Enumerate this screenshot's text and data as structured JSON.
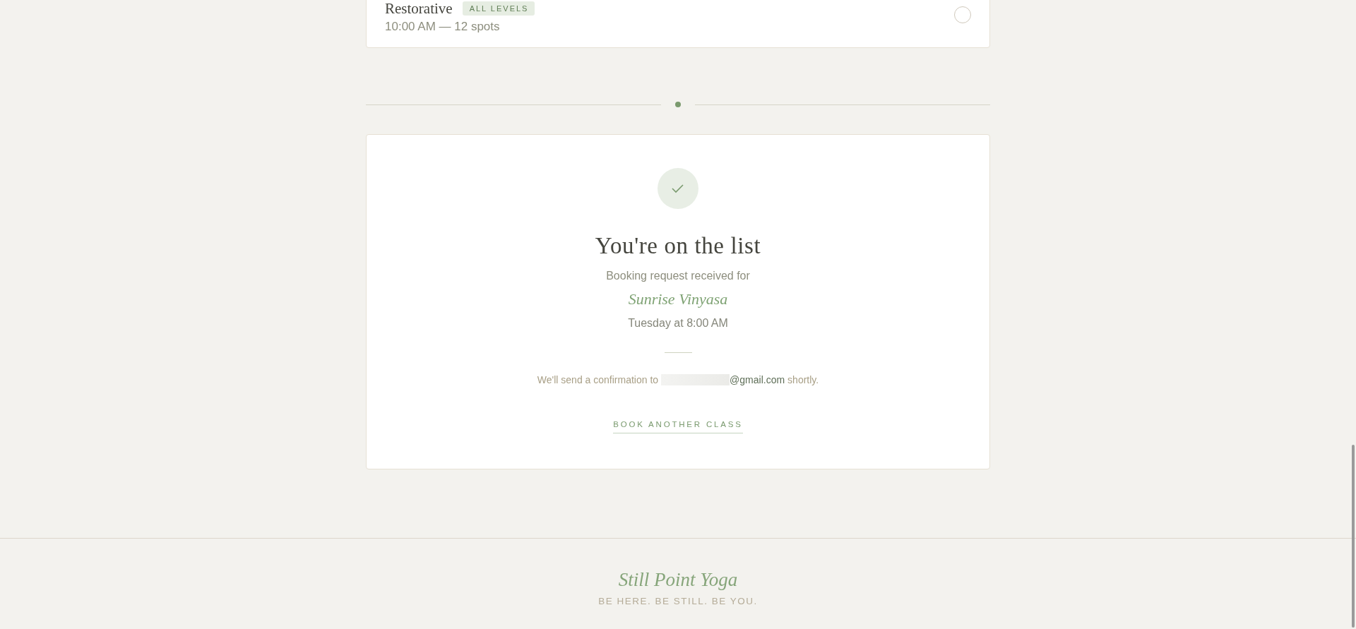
{
  "class_options": [
    {
      "name": "Restorative",
      "badge": "ALL LEVELS",
      "details": "10:00 AM — 12 spots",
      "selected": false
    }
  ],
  "confirmation": {
    "title": "You're on the list",
    "intro": "Booking request received for",
    "class_name": "Sunrise Vinyasa",
    "when": "Tuesday at 8:00 AM",
    "notice_before": "We'll send a confirmation to",
    "email_hidden": true,
    "email": "@gmail.com",
    "notice_after": "shortly.",
    "action": "BOOK ANOTHER CLASS"
  },
  "footer": {
    "brand": "Still Point Yoga",
    "tagline": "BE HERE. BE STILL. BE YOU."
  }
}
